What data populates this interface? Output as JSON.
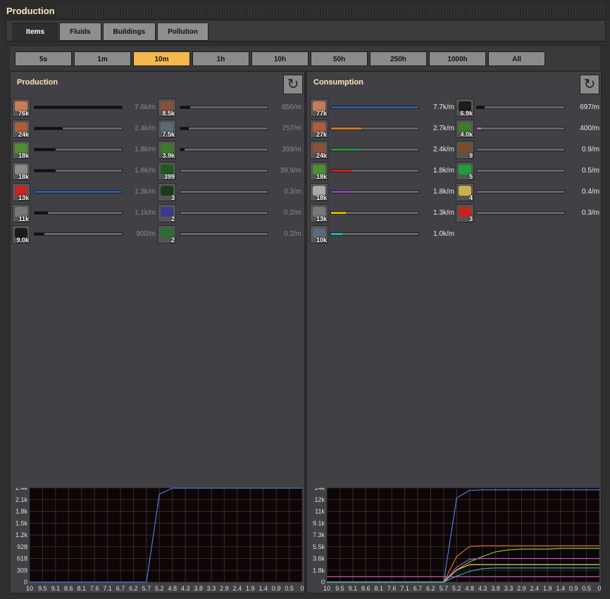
{
  "window": {
    "title": "Production"
  },
  "tabs": [
    {
      "label": "Items",
      "active": true
    },
    {
      "label": "Fluids"
    },
    {
      "label": "Buildings"
    },
    {
      "label": "Pollution"
    }
  ],
  "time_buttons": [
    {
      "label": "5s"
    },
    {
      "label": "1m"
    },
    {
      "label": "10m",
      "active": true
    },
    {
      "label": "1h"
    },
    {
      "label": "10h"
    },
    {
      "label": "50h"
    },
    {
      "label": "250h"
    },
    {
      "label": "1000h"
    },
    {
      "label": "All"
    }
  ],
  "colors": {
    "blue": "#2e5aa8",
    "orange": "#d9731d",
    "green": "#2f8f45",
    "red": "#c0232b",
    "purple": "#8a3fb3",
    "yellow": "#d4b400",
    "teal": "#2aaeb6",
    "pink": "#e05bd0",
    "black": "#111111"
  },
  "production": {
    "title": "Production",
    "col1": [
      {
        "icon": "copper-cable-icon",
        "count": "76k",
        "rate": "7.6k/m",
        "fill": 1.0,
        "color": "#111111",
        "iconColor": "#c77c55"
      },
      {
        "icon": "copper-plate-icon",
        "count": "24k",
        "rate": "2.4k/m",
        "fill": 0.32,
        "color": "#111111",
        "iconColor": "#b05b3b"
      },
      {
        "icon": "electronic-circuit-icon",
        "count": "18k",
        "rate": "1.8k/m",
        "fill": 0.24,
        "color": "#111111",
        "iconColor": "#4f8f2f"
      },
      {
        "icon": "iron-plate-icon",
        "count": "18k",
        "rate": "1.8k/m",
        "fill": 0.24,
        "color": "#111111",
        "iconColor": "#8a8a8a"
      },
      {
        "icon": "transport-belt-icon",
        "count": "13k",
        "rate": "1.3k/m",
        "fill": 1.0,
        "color": "#2e5aa8",
        "iconColor": "#c8231f"
      },
      {
        "icon": "steel-plate-icon",
        "count": "11k",
        "rate": "1.1k/m",
        "fill": 0.15,
        "color": "#111111",
        "iconColor": "#777777"
      },
      {
        "icon": "coal-icon",
        "count": "9.0k",
        "rate": "900/m",
        "fill": 0.11,
        "color": "#111111",
        "iconColor": "#1c1c1c"
      }
    ],
    "col2": [
      {
        "icon": "copper-ore-icon",
        "count": "8.5k",
        "rate": "856/m",
        "fill": 0.11,
        "color": "#111111",
        "iconColor": "#8a5038"
      },
      {
        "icon": "iron-ore-icon",
        "count": "7.5k",
        "rate": "757/m",
        "fill": 0.1,
        "color": "#111111",
        "iconColor": "#5a6a7a"
      },
      {
        "icon": "wood-icon",
        "count": "3.9k",
        "rate": "399/m",
        "fill": 0.05,
        "color": "#111111",
        "iconColor": "#3d7a2d"
      },
      {
        "icon": "stone-icon",
        "count": "399",
        "rate": "39.9/m",
        "fill": 0.0,
        "color": "#111111",
        "iconColor": "#1e5a1e"
      },
      {
        "icon": "pipe-icon",
        "count": "3",
        "rate": "0.3/m",
        "fill": 0.0,
        "color": "#111111",
        "iconColor": "#1c3b1c"
      },
      {
        "icon": "inserter-icon",
        "count": "2",
        "rate": "0.2/m",
        "fill": 0.0,
        "color": "#111111",
        "iconColor": "#3a3a8c"
      },
      {
        "icon": "tree-icon",
        "count": "2",
        "rate": "0.2/m",
        "fill": 0.0,
        "color": "#111111",
        "iconColor": "#2e6e2e"
      }
    ],
    "chart_data": {
      "type": "line",
      "x": [
        "10",
        "9.5",
        "9.1",
        "8.6",
        "8.1",
        "7.6",
        "7.1",
        "6.7",
        "6.2",
        "5.7",
        "5.2",
        "4.8",
        "4.3",
        "3.8",
        "3.3",
        "2.9",
        "2.4",
        "1.9",
        "1.4",
        "0.9",
        "0.5",
        "0"
      ],
      "yticks": [
        "2.4k",
        "2.1k",
        "1.8k",
        "1.5k",
        "1.2k",
        "928",
        "618",
        "309",
        "0"
      ],
      "ylim": [
        0,
        2470
      ],
      "series": [
        {
          "color": "#4a7ee0",
          "values": [
            0,
            0,
            0,
            0,
            0,
            0,
            0,
            0,
            0,
            0,
            2300,
            2460,
            2460,
            2460,
            2460,
            2460,
            2460,
            2460,
            2460,
            2460,
            2460,
            2460
          ]
        }
      ]
    }
  },
  "consumption": {
    "title": "Consumption",
    "col1": [
      {
        "icon": "copper-cable-icon",
        "count": "77k",
        "rate": "7.7k/m",
        "fill": 1.0,
        "color": "#2e5aa8",
        "iconColor": "#c77c55"
      },
      {
        "icon": "copper-plate-icon",
        "count": "27k",
        "rate": "2.7k/m",
        "fill": 0.35,
        "color": "#d9731d",
        "iconColor": "#b05b3b"
      },
      {
        "icon": "copper-ore-icon",
        "count": "24k",
        "rate": "2.4k/m",
        "fill": 0.32,
        "color": "#2f8f45",
        "iconColor": "#8a5038"
      },
      {
        "icon": "electronic-circuit-icon",
        "count": "18k",
        "rate": "1.8k/m",
        "fill": 0.24,
        "color": "#c0232b",
        "iconColor": "#4f8f2f"
      },
      {
        "icon": "iron-plate-icon",
        "count": "18k",
        "rate": "1.8k/m",
        "fill": 0.24,
        "color": "#8a3fb3",
        "iconColor": "#aaaaaa"
      },
      {
        "icon": "steel-plate-icon",
        "count": "13k",
        "rate": "1.3k/m",
        "fill": 0.17,
        "color": "#d4b400",
        "iconColor": "#777777"
      },
      {
        "icon": "iron-ore-icon",
        "count": "10k",
        "rate": "1.0k/m",
        "fill": 0.13,
        "color": "#2aaeb6",
        "iconColor": "#5a6a7a"
      }
    ],
    "col2": [
      {
        "icon": "coal-icon",
        "count": "6.9k",
        "rate": "697/m",
        "fill": 0.09,
        "color": "#111111",
        "iconColor": "#1c1c1c"
      },
      {
        "icon": "wood-icon",
        "count": "4.0k",
        "rate": "400/m",
        "fill": 0.05,
        "color": "#e05bd0",
        "iconColor": "#3d7a2d"
      },
      {
        "icon": "wooden-chest-icon",
        "count": "9",
        "rate": "0.9/m",
        "fill": 0.0,
        "color": "#111111",
        "iconColor": "#7a4a2a"
      },
      {
        "icon": "green-circuit-icon",
        "count": "5",
        "rate": "0.5/m",
        "fill": 0.0,
        "color": "#111111",
        "iconColor": "#1f9e3a"
      },
      {
        "icon": "gear-icon",
        "count": "4",
        "rate": "0.4/m",
        "fill": 0.0,
        "color": "#111111",
        "iconColor": "#c9b04a"
      },
      {
        "icon": "transport-belt-icon",
        "count": "3",
        "rate": "0.3/m",
        "fill": 0.0,
        "color": "#111111",
        "iconColor": "#c8231f"
      }
    ],
    "chart_data": {
      "type": "line",
      "x": [
        "10",
        "9.5",
        "9.1",
        "8.6",
        "8.1",
        "7.6",
        "7.1",
        "6.7",
        "6.2",
        "5.7",
        "5.2",
        "4.8",
        "4.3",
        "3.8",
        "3.3",
        "2.9",
        "2.4",
        "1.9",
        "1.4",
        "0.9",
        "0.5",
        "0"
      ],
      "yticks": [
        "14k",
        "12k",
        "11k",
        "9.1k",
        "7.3k",
        "5.5k",
        "3.6k",
        "1.8k",
        "0"
      ],
      "ylim": [
        0,
        14000
      ],
      "series": [
        {
          "color": "#4a7ee0",
          "values": [
            0,
            0,
            0,
            0,
            0,
            0,
            0,
            0,
            0,
            0,
            12500,
            13600,
            13700,
            13700,
            13700,
            13700,
            13700,
            13700,
            13700,
            13700,
            13700,
            13700
          ]
        },
        {
          "color": "#d9731d",
          "values": [
            0,
            0,
            0,
            0,
            0,
            0,
            0,
            0,
            0,
            0,
            3800,
            5300,
            5400,
            5400,
            5400,
            5400,
            5400,
            5400,
            5400,
            5400,
            5400,
            5400
          ]
        },
        {
          "color": "#7fbf3f",
          "values": [
            0,
            0,
            0,
            0,
            0,
            0,
            0,
            0,
            0,
            0,
            1800,
            3000,
            3800,
            4500,
            4800,
            4900,
            4900,
            4900,
            5000,
            5000,
            5000,
            5000
          ]
        },
        {
          "color": "#b05bd0",
          "values": [
            0,
            0,
            0,
            0,
            0,
            0,
            0,
            0,
            0,
            0,
            2200,
            3400,
            3500,
            3500,
            3500,
            3500,
            3500,
            3500,
            3500,
            3500,
            3500,
            3500
          ]
        },
        {
          "color": "#e6d34a",
          "values": [
            0,
            0,
            0,
            0,
            0,
            0,
            0,
            0,
            0,
            0,
            1800,
            2600,
            2600,
            2600,
            2600,
            2600,
            2600,
            2600,
            2600,
            2600,
            2600,
            2600
          ]
        },
        {
          "color": "#2aaeb6",
          "values": [
            0,
            0,
            0,
            0,
            0,
            0,
            0,
            0,
            0,
            0,
            900,
            1600,
            2000,
            2100,
            2100,
            2100,
            2100,
            2100,
            2100,
            2100,
            2100,
            2100
          ]
        },
        {
          "color": "#e05bd0",
          "values": [
            800,
            800,
            800,
            800,
            800,
            800,
            800,
            800,
            800,
            800,
            800,
            800,
            800,
            800,
            800,
            800,
            800,
            800,
            800,
            800,
            800,
            800
          ]
        }
      ]
    }
  }
}
